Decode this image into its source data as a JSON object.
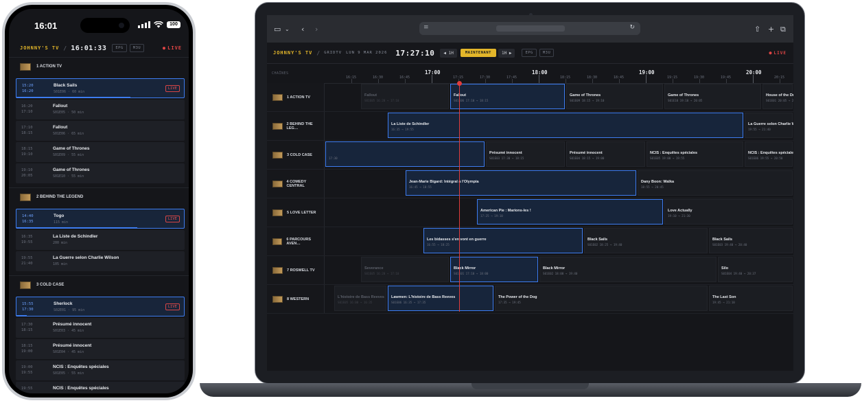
{
  "phone": {
    "status_time": "16:01",
    "battery": "100",
    "brand": "JOHNNY'S TV",
    "separator": "/",
    "clock": "16:01:33",
    "pill1": "EPG",
    "pill2": "M3U",
    "live": "LIVE",
    "channels": [
      {
        "name": "1 ACTION TV",
        "programs": [
          {
            "start": "15:20",
            "end": "16:20",
            "title": "Black Sails",
            "sub": "S01E06 · 60 min",
            "live": "LIVE",
            "current": true,
            "progress": 0.68
          },
          {
            "start": "16:20",
            "end": "17:10",
            "title": "Fallout",
            "sub": "S01E05 · 50 min"
          },
          {
            "start": "17:10",
            "end": "18:15",
            "title": "Fallout",
            "sub": "S01E06 · 65 min"
          },
          {
            "start": "18:15",
            "end": "19:10",
            "title": "Game of Thrones",
            "sub": "S01E09 · 55 min"
          },
          {
            "start": "19:10",
            "end": "20:05",
            "title": "Game of Thrones",
            "sub": "S01E10 · 55 min"
          }
        ]
      },
      {
        "name": "2 BEHIND THE LEGEND",
        "programs": [
          {
            "start": "14:40",
            "end": "16:35",
            "title": "Togo",
            "sub": "115 min",
            "live": "LIVE",
            "current": true,
            "progress": 0.72
          },
          {
            "start": "16:35",
            "end": "19:55",
            "title": "La Liste de Schindler",
            "sub": "200 min"
          },
          {
            "start": "19:55",
            "end": "21:40",
            "title": "La Guerre selon Charlie Wilson",
            "sub": "105 min"
          }
        ]
      },
      {
        "name": "3 COLD CASE",
        "programs": [
          {
            "start": "15:55",
            "end": "17:30",
            "title": "Sherlock",
            "sub": "S02E01 · 95 min",
            "live": "LIVE",
            "current": true,
            "progress": 0.06
          },
          {
            "start": "17:30",
            "end": "18:15",
            "title": "Présumé innocent",
            "sub": "S01E03 · 45 min"
          },
          {
            "start": "18:15",
            "end": "19:00",
            "title": "Présumé innocent",
            "sub": "S01E04 · 45 min"
          },
          {
            "start": "19:00",
            "end": "19:55",
            "title": "NCIS : Enquêtes spéciales",
            "sub": "S01E05 · 55 min"
          },
          {
            "start": "19:55",
            "end": "",
            "title": "NCIS : Enquêtes spéciales",
            "sub": ""
          }
        ]
      }
    ]
  },
  "laptop": {
    "brand": "JOHNNY'S TV",
    "separator": "/",
    "app": "GRIDTV",
    "date": "LUN 9 MAR 2026",
    "clock": "17:27:10",
    "prev": "◀ 1H",
    "now": "MAINTENANT",
    "next": "1H ▶",
    "pill1": "EPG",
    "pill2": "M3U",
    "live": "LIVE",
    "channels_header": "CHAÎNES",
    "timeline": [
      {
        "label": "16:15",
        "big": false
      },
      {
        "label": "16:30",
        "big": false
      },
      {
        "label": "16:45",
        "big": false
      },
      {
        "label": "17:00",
        "big": true
      },
      {
        "label": "17:15",
        "big": false
      },
      {
        "label": "17:30",
        "big": false
      },
      {
        "label": "17:45",
        "big": false
      },
      {
        "label": "18:00",
        "big": true
      },
      {
        "label": "18:15",
        "big": false
      },
      {
        "label": "18:30",
        "big": false
      },
      {
        "label": "18:45",
        "big": false
      },
      {
        "label": "19:00",
        "big": true
      },
      {
        "label": "19:15",
        "big": false
      },
      {
        "label": "19:30",
        "big": false
      },
      {
        "label": "19:45",
        "big": false
      },
      {
        "label": "20:00",
        "big": true
      },
      {
        "label": "20:15",
        "big": false
      },
      {
        "label": "20:30",
        "big": false
      }
    ],
    "rows": [
      {
        "name": "1 ACTION TV",
        "blocks": [
          {
            "start": "16:20",
            "end": "17:10",
            "title": "Fallout",
            "sub": "S01E05 16:20 → 17:10",
            "state": "past"
          },
          {
            "start": "17:10",
            "end": "18:15",
            "title": "Fallout",
            "sub": "S01E06 17:10 → 18:15",
            "state": "cur"
          },
          {
            "start": "18:15",
            "end": "19:10",
            "title": "Game of Thrones",
            "sub": "S01E09 18:15 → 19:10",
            "state": ""
          },
          {
            "start": "19:10",
            "end": "20:05",
            "title": "Game of Thrones",
            "sub": "S01E10 19:10 → 20:05",
            "state": ""
          },
          {
            "start": "20:05",
            "end": "21:00",
            "title": "House of the Dragon",
            "sub": "S01E01 20:05 → 21:00",
            "state": ""
          }
        ]
      },
      {
        "name": "2 BEHIND THE LEG…",
        "blocks": [
          {
            "start": "16:35",
            "end": "19:55",
            "title": "La Liste de Schindler",
            "sub": "16:35 → 19:55",
            "state": "cur"
          },
          {
            "start": "19:55",
            "end": "21:40",
            "title": "La Guerre selon Charlie Wilson",
            "sub": "19:55 → 21:40",
            "state": ""
          }
        ]
      },
      {
        "name": "3 COLD CASE",
        "blocks": [
          {
            "start": "15:55",
            "end": "17:30",
            "title": "",
            "sub": "17:30",
            "state": "cur"
          },
          {
            "start": "17:30",
            "end": "18:15",
            "title": "Présumé innocent",
            "sub": "S01E03 17:30 → 18:15",
            "state": ""
          },
          {
            "start": "18:15",
            "end": "19:00",
            "title": "Présumé innocent",
            "sub": "S01E04 18:15 → 19:00",
            "state": ""
          },
          {
            "start": "19:00",
            "end": "19:55",
            "title": "NCIS : Enquêtes spéciales",
            "sub": "S01E05 19:00 → 19:55",
            "state": ""
          },
          {
            "start": "19:55",
            "end": "20:50",
            "title": "NCIS : Enquêtes spéciales",
            "sub": "S01E06 19:55 → 20:50",
            "state": ""
          },
          {
            "start": "20:50",
            "end": "21:30",
            "title": "Tr",
            "sub": "",
            "state": ""
          }
        ]
      },
      {
        "name": "4 COMEDY CENTRAL",
        "blocks": [
          {
            "start": "16:45",
            "end": "18:55",
            "title": "Jean-Marie Bigard: Intégral à l'Olympia",
            "sub": "16:45 → 18:55",
            "state": "cur"
          },
          {
            "start": "18:55",
            "end": "20:30",
            "title": "Dany Boon: Waïka",
            "sub": "18:55 → 20:45",
            "state": ""
          }
        ]
      },
      {
        "name": "5 LOVE LETTER",
        "blocks": [
          {
            "start": "17:25",
            "end": "19:10",
            "title": "American Pie : Marions-les !",
            "sub": "17:25 → 19:10",
            "state": "cur"
          },
          {
            "start": "19:10",
            "end": "21:30",
            "title": "Love Actually",
            "sub": "19:10 → 21:30",
            "state": ""
          }
        ]
      },
      {
        "name": "6 PARCOURS AVEN…",
        "blocks": [
          {
            "start": "16:55",
            "end": "18:25",
            "title": "Les bidasses s'en vont en guerre",
            "sub": "16:55 → 18:25",
            "state": "cur"
          },
          {
            "start": "18:25",
            "end": "19:35",
            "title": "Black Sails",
            "sub": "S01E02 18:25 → 19:40",
            "state": ""
          },
          {
            "start": "19:35",
            "end": "20:45",
            "title": "Black Sails",
            "sub": "S01E03 19:40 → 20:40",
            "state": ""
          }
        ]
      },
      {
        "name": "7 ROSWELL TV",
        "blocks": [
          {
            "start": "16:20",
            "end": "17:10",
            "title": "Severance",
            "sub": "S01E05 16:20 → 17:10",
            "state": "past"
          },
          {
            "start": "17:10",
            "end": "18:00",
            "title": "Black Mirror",
            "sub": "S01E01 17:10 → 18:00",
            "state": "cur"
          },
          {
            "start": "18:00",
            "end": "19:40",
            "title": "Black Mirror",
            "sub": "S01E02 18:00 → 19:40",
            "state": ""
          },
          {
            "start": "19:40",
            "end": "20:40",
            "title": "Silo",
            "sub": "S01E04 19:40 → 20:37",
            "state": ""
          }
        ]
      },
      {
        "name": "8 WESTERN",
        "blocks": [
          {
            "start": "16:05",
            "end": "16:35",
            "title": "L'histoire de Bass Reeves",
            "sub": "S01E05 16:00 → 16:35",
            "state": "past"
          },
          {
            "start": "16:35",
            "end": "17:35",
            "title": "Lawmen: L'histoire de Bass Reeves",
            "sub": "S01E06 16:35 → 17:35",
            "state": "cur"
          },
          {
            "start": "17:35",
            "end": "19:35",
            "title": "The Power of the Dog",
            "sub": "17:35 → 19:45",
            "state": ""
          },
          {
            "start": "19:35",
            "end": "20:45",
            "title": "The Last Son",
            "sub": "19:45 → 21:10",
            "state": ""
          }
        ]
      }
    ]
  }
}
